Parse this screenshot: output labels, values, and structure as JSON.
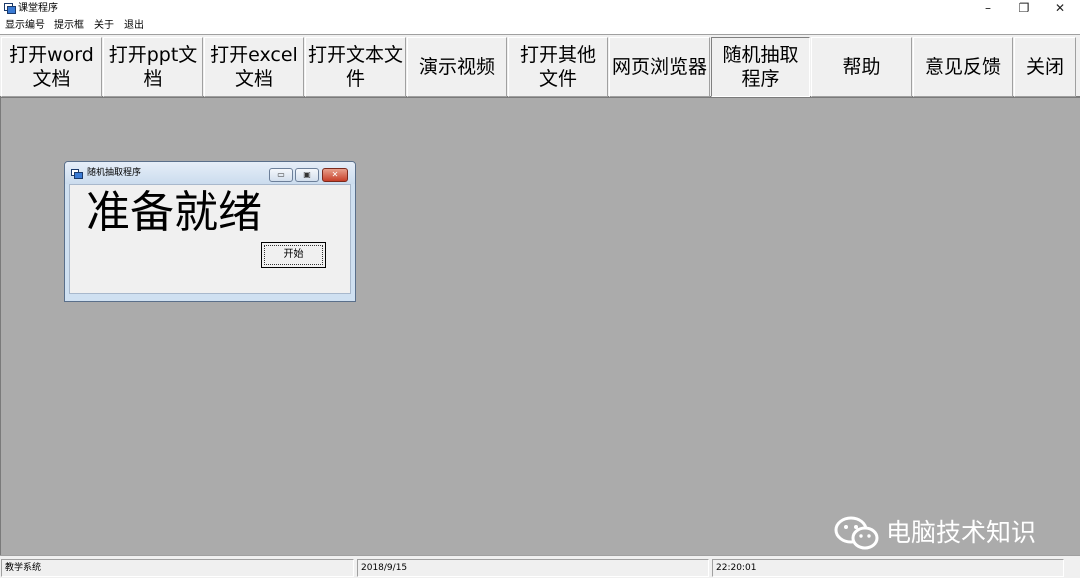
{
  "window": {
    "title": "课堂程序",
    "icons": {
      "app": "app-icon",
      "minimize": "minimize-icon",
      "maximize": "restore-icon",
      "close": "close-icon"
    },
    "controls": {
      "minimize": "–",
      "maximize": "❐",
      "close": "✕"
    }
  },
  "menu": {
    "items": [
      "显示编号",
      "提示框",
      "关于",
      "退出"
    ]
  },
  "toolbar": {
    "buttons": [
      {
        "label": "打开word文档"
      },
      {
        "label": "打开ppt文档"
      },
      {
        "label": "打开excel文档"
      },
      {
        "label": "打开文本文件"
      },
      {
        "label": "演示视频"
      },
      {
        "label": "打开其他文件"
      },
      {
        "label": "网页浏览器"
      },
      {
        "label": "随机抽取程序",
        "active": true
      },
      {
        "label": "帮助"
      },
      {
        "label": "意见反馈"
      },
      {
        "label": "关闭"
      }
    ]
  },
  "child_window": {
    "title": "随机抽取程序",
    "status_text": "准备就绪",
    "start_label": "开始",
    "controls": {
      "minimize": "▭",
      "maximize": "▣",
      "close": "✕"
    }
  },
  "watermark": {
    "text": "电脑技术知识",
    "icon": "wechat-icon"
  },
  "statusbar": {
    "panels": [
      "教学系统",
      "2018/9/15",
      "22:20:01"
    ]
  },
  "colors": {
    "workspace": "#ababab",
    "chrome": "#f0f0f0",
    "child_frame": "#cfe0f1",
    "close_red": "#c7402a"
  }
}
